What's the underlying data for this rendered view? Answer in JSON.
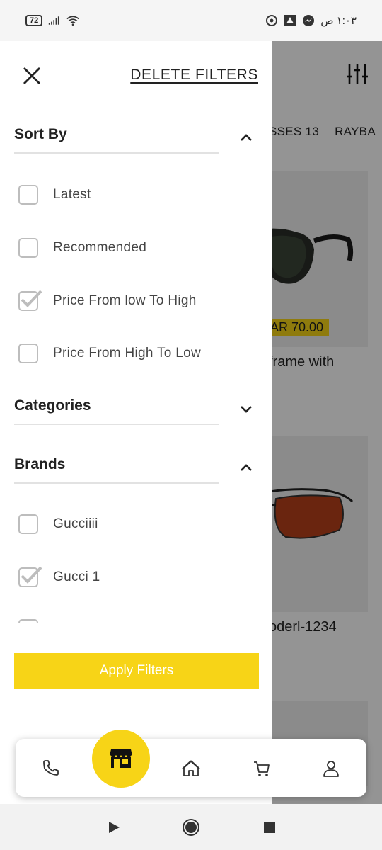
{
  "status_bar": {
    "battery": "72",
    "time": "١:٠٣ ص",
    "icons": [
      "battery-icon",
      "signal-icon",
      "wifi-icon",
      "app-notification-icon",
      "app-notification-icon",
      "messenger-icon"
    ]
  },
  "background": {
    "tabs": [
      "SSES 13",
      "RAYBA"
    ],
    "products": [
      {
        "price": "AR 70.00",
        "name": "frame with"
      },
      {
        "name": "oderl-1234"
      }
    ]
  },
  "drawer": {
    "delete_filters": "DELETE FILTERS",
    "sort_by": {
      "title": "Sort By",
      "expanded": true,
      "options": [
        {
          "label": "Latest",
          "checked": false
        },
        {
          "label": "Recommended",
          "checked": false
        },
        {
          "label": "Price From low To High",
          "checked": true
        },
        {
          "label": "Price From High To Low",
          "checked": false
        }
      ]
    },
    "categories": {
      "title": "Categories",
      "expanded": false
    },
    "brands": {
      "title": "Brands",
      "expanded": true,
      "options": [
        {
          "label": "Gucciiii",
          "checked": false
        },
        {
          "label": "Gucci 1",
          "checked": true
        }
      ]
    },
    "apply_label": "Apply Filters"
  },
  "bottom_nav": {
    "items": [
      "phone-icon",
      "store-icon",
      "home-icon",
      "cart-icon",
      "profile-icon"
    ]
  },
  "colors": {
    "accent": "#f7d417",
    "overlay": "#000000"
  }
}
